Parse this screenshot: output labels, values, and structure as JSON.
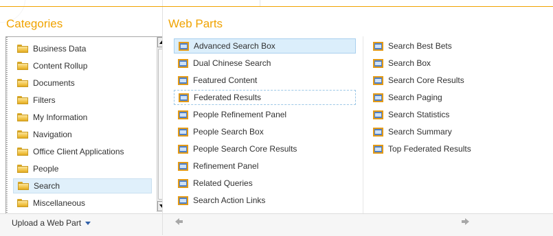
{
  "categories": {
    "heading": "Categories",
    "items": [
      {
        "label": "Business Data",
        "selected": false
      },
      {
        "label": "Content Rollup",
        "selected": false
      },
      {
        "label": "Documents",
        "selected": false
      },
      {
        "label": "Filters",
        "selected": false
      },
      {
        "label": "My Information",
        "selected": false
      },
      {
        "label": "Navigation",
        "selected": false
      },
      {
        "label": "Office Client Applications",
        "selected": false
      },
      {
        "label": "People",
        "selected": false
      },
      {
        "label": "Search",
        "selected": true
      },
      {
        "label": "Miscellaneous",
        "selected": false
      }
    ],
    "upload_label": "Upload a Web Part"
  },
  "web_parts": {
    "heading": "Web Parts",
    "column1": [
      {
        "label": "Advanced Search Box",
        "selected": true
      },
      {
        "label": "Dual Chinese Search",
        "selected": false
      },
      {
        "label": "Featured Content",
        "selected": false
      },
      {
        "label": "Federated Results",
        "selected": false,
        "focused": true
      },
      {
        "label": "People Refinement Panel",
        "selected": false
      },
      {
        "label": "People Search Box",
        "selected": false
      },
      {
        "label": "People Search Core Results",
        "selected": false
      },
      {
        "label": "Refinement Panel",
        "selected": false
      },
      {
        "label": "Related Queries",
        "selected": false
      },
      {
        "label": "Search Action Links",
        "selected": false
      }
    ],
    "column2": [
      {
        "label": "Search Best Bets"
      },
      {
        "label": "Search Box"
      },
      {
        "label": "Search Core Results"
      },
      {
        "label": "Search Paging"
      },
      {
        "label": "Search Statistics"
      },
      {
        "label": "Search Summary"
      },
      {
        "label": "Top Federated Results"
      }
    ]
  },
  "colors": {
    "accent": "#f0a300",
    "selection": "#dbeefb",
    "text": "#303030"
  }
}
